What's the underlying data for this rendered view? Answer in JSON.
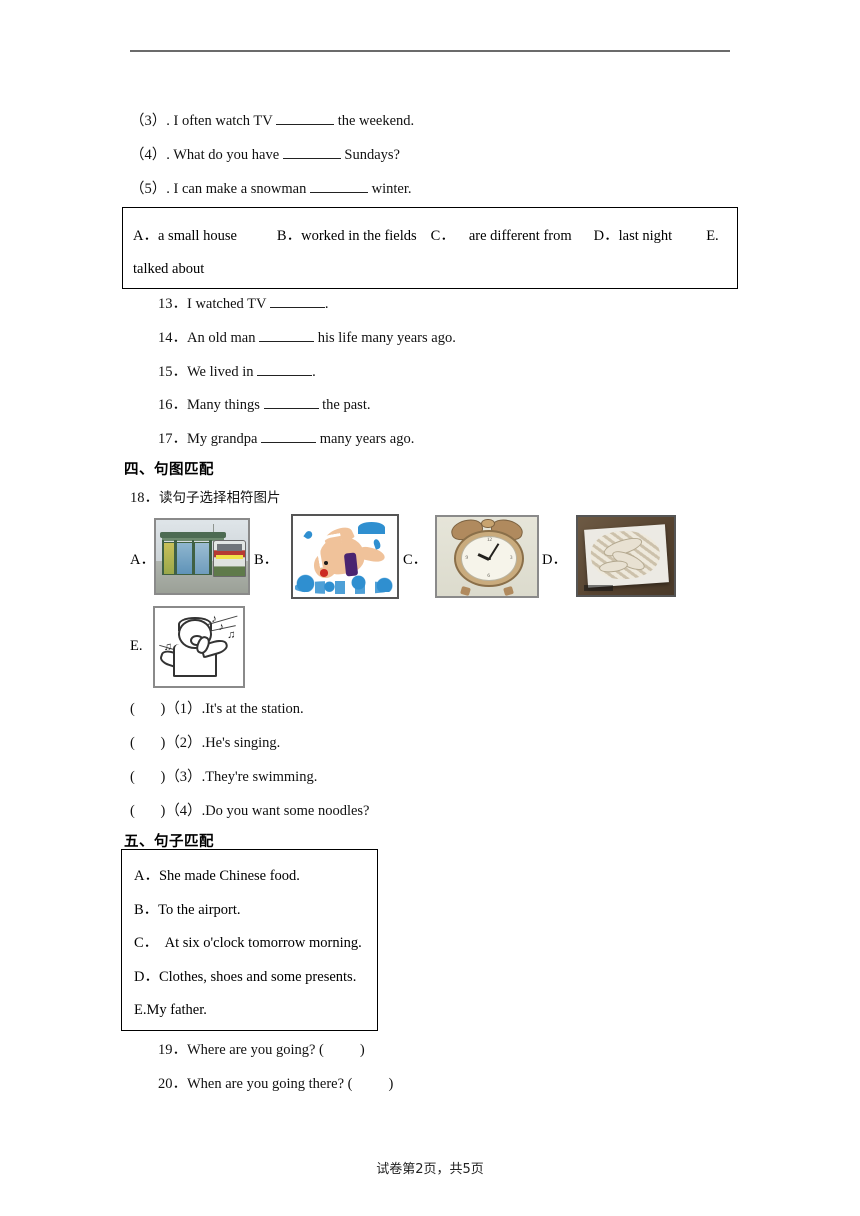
{
  "page": {
    "footer": "试卷第2页，共5页"
  },
  "fill_in_items": [
    {
      "num": "（3）",
      "pre": ". I often watch TV",
      "post": "the weekend."
    },
    {
      "num": "（4）",
      "pre": ". What do you have",
      "post": "Sundays?"
    },
    {
      "num": "（5）",
      "pre": ". I can make a snowman",
      "post": "winter."
    }
  ],
  "word_bank": {
    "a_label": "A．",
    "a_text": "a small house",
    "b_label": "B．",
    "b_text": "worked in the fields",
    "c_label": "C．",
    "c_text": "are different from",
    "d_label": "D．",
    "d_text": "last night",
    "e_label": "E.",
    "e_text": "talked about"
  },
  "numbered_items": [
    {
      "num": "13．",
      "pre": "I watched TV",
      "post": "."
    },
    {
      "num": "14．",
      "pre": "An old man",
      "post": "his life many years ago."
    },
    {
      "num": "15．",
      "pre": "We lived in",
      "post": "."
    },
    {
      "num": "16．",
      "pre": "Many things",
      "post": "the past."
    },
    {
      "num": "17．",
      "pre": "My grandpa",
      "post": "many years ago."
    }
  ],
  "section_four": {
    "heading": "四、句图匹配",
    "prompt_num": "18．",
    "prompt_text": "读句子选择相符图片",
    "images": [
      {
        "label": "A．",
        "icon": "bus-station-photo"
      },
      {
        "label": "B．",
        "icon": "swimming-cartoon"
      },
      {
        "label": "C．",
        "icon": "alarm-clock-photo"
      },
      {
        "label": "D．",
        "icon": "noodles-photo"
      },
      {
        "label": "E.",
        "icon": "singing-boy-drawing"
      }
    ],
    "questions": [
      {
        "bracket_open": "(",
        "bracket_close": ")",
        "num": "（1）",
        "text": ".It's at the station."
      },
      {
        "bracket_open": "(",
        "bracket_close": ")",
        "num": "（2）",
        "text": ".He's singing."
      },
      {
        "bracket_open": "(",
        "bracket_close": ")",
        "num": "（3）",
        "text": ".They're swimming."
      },
      {
        "bracket_open": "(",
        "bracket_close": ")",
        "num": "（4）",
        "text": ".Do you want some noodles?"
      }
    ]
  },
  "section_five": {
    "heading": "五、句子匹配",
    "options": [
      {
        "label": "A．",
        "text": "She made Chinese food."
      },
      {
        "label": "B．",
        "text": "To the airport."
      },
      {
        "label": "C．",
        "text": "  At six o'clock tomorrow morning."
      },
      {
        "label": "D．",
        "text": "Clothes, shoes and some presents."
      },
      {
        "label": "E.",
        "text": "My father."
      }
    ],
    "questions": [
      {
        "num": "19．",
        "text": "Where are you going? (",
        "close": ")"
      },
      {
        "num": "20．",
        "text": "When are you going there? (",
        "close": ")"
      }
    ]
  }
}
